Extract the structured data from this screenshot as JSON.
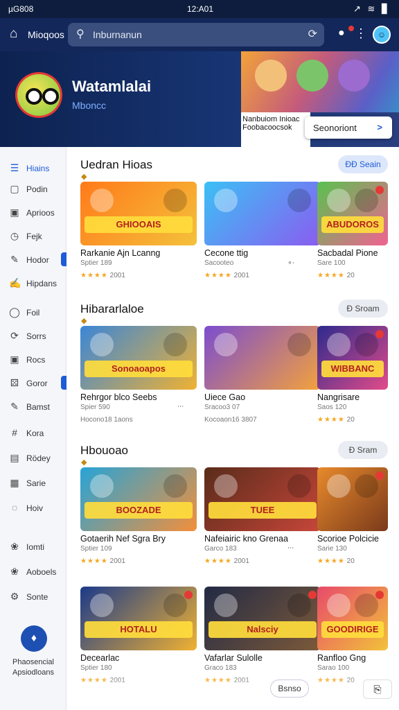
{
  "status": {
    "time_left": "µG808",
    "time_center": "12:A01",
    "icons": "↗ ≋ ▊"
  },
  "appbar": {
    "title": "Mioqoos",
    "search_value": "Inburnanun"
  },
  "hero": {
    "title": "Watamlalai",
    "subtitle": "Mboncc",
    "caption_line1": "Nanbuiom Inioac",
    "caption_line2": "Foobacoocsok",
    "button": "Seonoriont",
    "button_icon": ">"
  },
  "sidebar": [
    {
      "icon": "☰",
      "label": "Hiains",
      "active": true
    },
    {
      "icon": "▢",
      "label": "Podin"
    },
    {
      "icon": "▣",
      "label": "Aprioos"
    },
    {
      "icon": "◷",
      "label": "Fejk"
    },
    {
      "icon": "✎",
      "label": "Hodor",
      "indicator": true
    },
    {
      "icon": "✍",
      "label": "Hipdans"
    },
    {
      "icon": "◯",
      "label": "Foil"
    },
    {
      "icon": "⟳",
      "label": "Sorrs"
    },
    {
      "icon": "▣",
      "label": "Rocs"
    },
    {
      "icon": "⚄",
      "label": "Goror",
      "indicator": true
    },
    {
      "icon": "✎",
      "label": "Bamst"
    },
    {
      "icon": "#",
      "label": "Kora"
    },
    {
      "icon": "▤",
      "label": "Rödey"
    },
    {
      "icon": "▦",
      "label": "Sarie"
    },
    {
      "icon": "◌",
      "label": "Hoiv"
    },
    {
      "icon": "❀",
      "label": "Iomti"
    },
    {
      "icon": "❀",
      "label": "Aoboels"
    },
    {
      "icon": "⚙",
      "label": "Sonte"
    }
  ],
  "sidebar_fab": {
    "label_line1": "Phaosencial",
    "label_line2": "Apsiodloans"
  },
  "sections": [
    {
      "title": "Uedran Hioas",
      "button": "ÐÐ Seain",
      "cards": [
        {
          "banner": "GHIOOAIS",
          "name": "Rarkanie Ajn Lcanng",
          "meta": "Sptier 189",
          "stars": "★★★★",
          "rating": "2001"
        },
        {
          "banner": "",
          "name": "Cecone ttig",
          "meta": "Sacooteo",
          "stars": "★★★★",
          "rating": "2001",
          "extra": "∘∙"
        },
        {
          "banner": "ABUDOROS",
          "name": "Sacbadal Pione",
          "meta": "Sare 100",
          "stars": "★★★★",
          "rating": "20"
        }
      ]
    },
    {
      "title": "Hibararlaloe",
      "button": "Ð Sroam",
      "cards": [
        {
          "banner": "Sonoaoapos",
          "name": "Rehrgor blco Seebs",
          "meta": "Spier 590",
          "stars": "",
          "rating": "Hocono18 1aons",
          "extra": "∙∙∙"
        },
        {
          "banner": "",
          "name": "Uiece Gao",
          "meta": "Sracoo3 07",
          "stars": "",
          "rating": "Kocoaon16 3807"
        },
        {
          "banner": "WIBBANC",
          "name": "Nangrisare",
          "meta": "Saos 120",
          "stars": "★★★★",
          "rating": "20"
        }
      ]
    },
    {
      "title": "Hbouoao",
      "button": "Ð Sram",
      "cards": [
        {
          "banner": "BOOZADE",
          "name": "Gotaerih Nef Sgra Bry",
          "meta": "Sptier 109",
          "stars": "★★★★",
          "rating": "2001"
        },
        {
          "banner": "TUEE",
          "name": "Nafeiairic kno Grenaa",
          "meta": "Garco 183",
          "stars": "★★★★",
          "rating": "2001",
          "extra": "∙∙∙"
        },
        {
          "banner": "",
          "name": "Scorioe Polcicie",
          "meta": "Sarie 130",
          "stars": "★★★★",
          "rating": "20"
        }
      ]
    },
    {
      "title": "",
      "button": "",
      "cards": [
        {
          "banner": "HOTALU",
          "name": "Decearlac",
          "meta": "Sptier 180",
          "stars": "★★★★",
          "rating": "2001"
        },
        {
          "banner": "Nalsciy",
          "name": "Vafarlar Sulolle",
          "meta": "Graco 183",
          "stars": "★★★★",
          "rating": "2001"
        },
        {
          "banner": "GOODIRIGE",
          "name": "Ranfloo Gng",
          "meta": "Sarao 100",
          "stars": "★★★★",
          "rating": "20"
        }
      ]
    }
  ],
  "more_button": "Bsnso",
  "float_button_icon": "⎘",
  "colors": {
    "primary": "#1e5bd7",
    "appbar": "#13275a",
    "stars": "#f5a623"
  }
}
